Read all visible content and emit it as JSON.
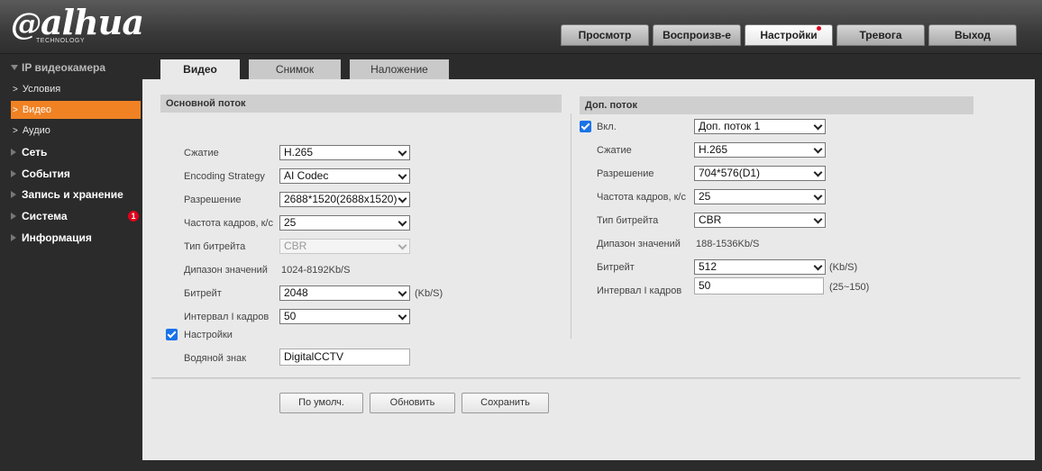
{
  "header": {
    "logo_text": "alhua",
    "logo_sub": "TECHNOLOGY",
    "tabs": [
      {
        "label": "Просмотр"
      },
      {
        "label": "Воспроизв-е"
      },
      {
        "label": "Настройки"
      },
      {
        "label": "Тревога"
      },
      {
        "label": "Выход"
      }
    ]
  },
  "sidebar": {
    "section": "IP видеокамера",
    "sub_items": [
      {
        "label": "Условия"
      },
      {
        "label": "Видео"
      },
      {
        "label": "Аудио"
      }
    ],
    "items": [
      {
        "label": "Сеть"
      },
      {
        "label": "События"
      },
      {
        "label": "Запись и хранение"
      },
      {
        "label": "Система",
        "badge": "1"
      },
      {
        "label": "Информация"
      }
    ]
  },
  "subtabs": [
    {
      "label": "Видео"
    },
    {
      "label": "Снимок"
    },
    {
      "label": "Наложение"
    }
  ],
  "main_stream": {
    "title": "Основной поток",
    "compression_label": "Сжатие",
    "compression": "H.265",
    "strategy_label": "Encoding Strategy",
    "strategy": "AI Codec",
    "resolution_label": "Разрешение",
    "resolution": "2688*1520(2688x1520)",
    "fps_label": "Частота кадров, к/с",
    "fps": "25",
    "bitrate_type_label": "Тип битрейта",
    "bitrate_type": "CBR",
    "range_label": "Дипазон значений",
    "range": "1024-8192Kb/S",
    "bitrate_label": "Битрейт",
    "bitrate": "2048",
    "bitrate_unit": "(Kb/S)",
    "iframe_label": "Интервал I кадров",
    "iframe": "50",
    "settings_label": "Настройки",
    "watermark_label": "Водяной знак",
    "watermark": "DigitalCCTV"
  },
  "sub_stream": {
    "title": "Доп. поток",
    "enable_label": "Вкл.",
    "stream": "Доп. поток 1",
    "compression_label": "Сжатие",
    "compression": "H.265",
    "resolution_label": "Разрешение",
    "resolution": "704*576(D1)",
    "fps_label": "Частота кадров, к/с",
    "fps": "25",
    "bitrate_type_label": "Тип битрейта",
    "bitrate_type": "CBR",
    "range_label": "Дипазон значений",
    "range": "188-1536Kb/S",
    "bitrate_label": "Битрейт",
    "bitrate": "512",
    "bitrate_unit": "(Kb/S)",
    "iframe_label": "Интервал I кадров",
    "iframe": "50",
    "iframe_range": "(25~150)"
  },
  "buttons": {
    "default": "По умолч.",
    "refresh": "Обновить",
    "save": "Сохранить"
  },
  "colors": {
    "accent": "#f08224",
    "badge": "#e0001b",
    "checkbox": "#1a73e8"
  }
}
